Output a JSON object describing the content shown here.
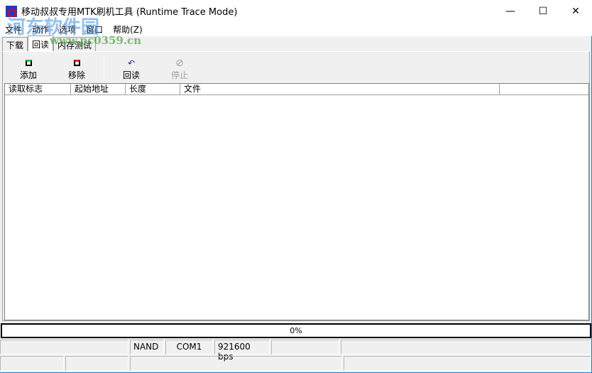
{
  "window": {
    "title": "移动叔叔专用MTK刷机工具 (Runtime Trace Mode)",
    "minimize": "—",
    "maximize": "☐",
    "close": "✕"
  },
  "menu": [
    "文件",
    "动作",
    "选项",
    "窗口",
    "帮助(Z)"
  ],
  "tabs": [
    "下载",
    "回读",
    "内存测试"
  ],
  "active_tab": "回读",
  "toolbar": [
    {
      "label": "添加",
      "icon": "add-icon"
    },
    {
      "label": "移除",
      "icon": "remove-icon"
    },
    {
      "label": "回读",
      "icon": "undo-icon"
    },
    {
      "label": "停止",
      "icon": "stop-icon",
      "disabled": true
    }
  ],
  "list": {
    "columns": [
      "读取标志",
      "起始地址",
      "长度",
      "文件"
    ],
    "rows": []
  },
  "progress": {
    "text": "0%",
    "value": 0
  },
  "status": {
    "row1": [
      "",
      "NAND",
      "COM1",
      "921600 bps",
      "",
      ""
    ],
    "row2": [
      "",
      "",
      "",
      ""
    ]
  },
  "watermark": {
    "text": "河东软件园",
    "url": "www.pc0359.cn"
  }
}
